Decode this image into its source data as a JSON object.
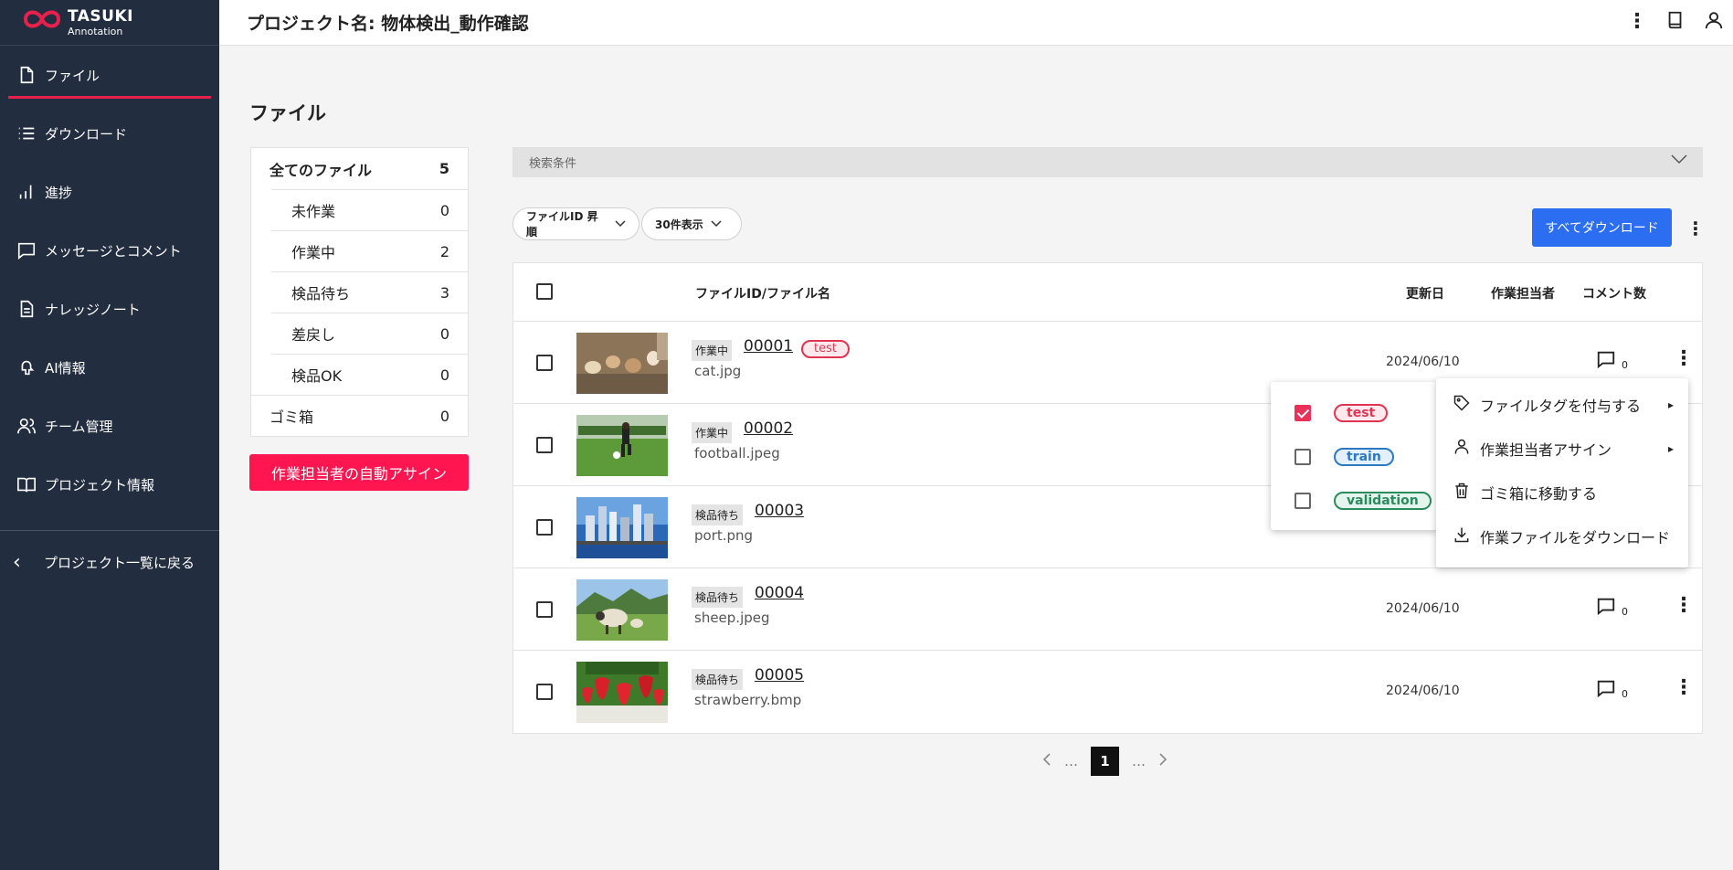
{
  "app": {
    "logo_title": "TASUKI",
    "logo_sub": "Annotation"
  },
  "sidebar": {
    "items": [
      {
        "label": "ファイル",
        "icon": "file-icon"
      },
      {
        "label": "ダウンロード",
        "icon": "list-icon"
      },
      {
        "label": "進捗",
        "icon": "bar-chart-icon"
      },
      {
        "label": "メッセージとコメント",
        "icon": "message-icon"
      },
      {
        "label": "ナレッジノート",
        "icon": "document-icon"
      },
      {
        "label": "AI情報",
        "icon": "ai-icon"
      },
      {
        "label": "チーム管理",
        "icon": "team-icon"
      },
      {
        "label": "プロジェクト情報",
        "icon": "book-icon"
      }
    ],
    "back_label": "プロジェクト一覧に戻る"
  },
  "header": {
    "project_title": "プロジェクト名: 物体検出_動作確認"
  },
  "page": {
    "title": "ファイル"
  },
  "summary": {
    "rows": [
      {
        "label": "全てのファイル",
        "count": "5"
      },
      {
        "label": "未作業",
        "count": "0"
      },
      {
        "label": "作業中",
        "count": "2"
      },
      {
        "label": "検品待ち",
        "count": "3"
      },
      {
        "label": "差戻し",
        "count": "0"
      },
      {
        "label": "検品OK",
        "count": "0"
      },
      {
        "label": "ゴミ箱",
        "count": "0"
      }
    ],
    "auto_assign_label": "作業担当者の自動アサイン"
  },
  "search": {
    "label": "検索条件"
  },
  "controls": {
    "sort_label": "ファイルID 昇順",
    "per_page_label": "30件表示",
    "download_all_label": "すべてダウンロード"
  },
  "table": {
    "headers": {
      "name": "ファイルID/ファイル名",
      "date": "更新日",
      "assignee": "作業担当者",
      "comments": "コメント数"
    },
    "rows": [
      {
        "status": "作業中",
        "id": "00001",
        "name": "cat.jpg",
        "tag": "test",
        "date": "2024/06/10",
        "comments": "0"
      },
      {
        "status": "作業中",
        "id": "00002",
        "name": "football.jpeg",
        "tag": "",
        "date": "",
        "comments": ""
      },
      {
        "status": "検品待ち",
        "id": "00003",
        "name": "port.png",
        "tag": "",
        "date": "",
        "comments": ""
      },
      {
        "status": "検品待ち",
        "id": "00004",
        "name": "sheep.jpeg",
        "tag": "",
        "date": "2024/06/10",
        "comments": "0"
      },
      {
        "status": "検品待ち",
        "id": "00005",
        "name": "strawberry.bmp",
        "tag": "",
        "date": "2024/06/10",
        "comments": "0"
      }
    ]
  },
  "pagination": {
    "current": "1",
    "ellipsis": "…"
  },
  "tag_popup": {
    "options": [
      {
        "label": "test",
        "checked": true,
        "color": "#e03552"
      },
      {
        "label": "train",
        "checked": false,
        "color": "#2b78c4"
      },
      {
        "label": "validation",
        "checked": false,
        "color": "#2b8a5e"
      }
    ]
  },
  "context_menu": {
    "items": [
      {
        "label": "ファイルタグを付与する",
        "icon": "tag-icon"
      },
      {
        "label": "作業担当者アサイン",
        "icon": "person-icon"
      },
      {
        "label": "ゴミ箱に移動する",
        "icon": "trash-icon"
      },
      {
        "label": "作業ファイルをダウンロード",
        "icon": "download-icon"
      }
    ]
  },
  "colors": {
    "sidebar_bg": "#232d40",
    "accent_red": "#ff1650",
    "primary_blue": "#2c6ef2"
  }
}
